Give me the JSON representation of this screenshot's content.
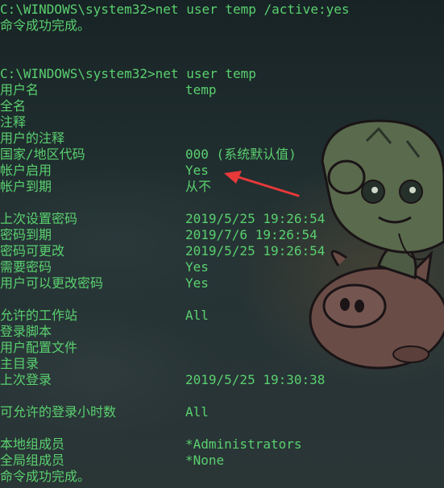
{
  "terminal": {
    "cmd1": "C:\\WINDOWS\\system32>net user temp /active:yes",
    "ok1": "命令成功完成。",
    "cmd2": "C:\\WINDOWS\\system32>net user temp",
    "fields": {
      "username": {
        "label": "用户名",
        "value": "temp"
      },
      "fullname": {
        "label": "全名",
        "value": ""
      },
      "comment": {
        "label": "注释",
        "value": ""
      },
      "user_comment": {
        "label": "用户的注释",
        "value": ""
      },
      "country_code": {
        "label": "国家/地区代码",
        "value": "000 (系统默认值)"
      },
      "account_active": {
        "label": "帐户启用",
        "value": "Yes"
      },
      "account_expires": {
        "label": "帐户到期",
        "value": "从不"
      },
      "pw_last_set": {
        "label": "上次设置密码",
        "value": "2019/5/25 19:26:54"
      },
      "pw_expires": {
        "label": "密码到期",
        "value": "2019/7/6 19:26:54"
      },
      "pw_changeable": {
        "label": "密码可更改",
        "value": "2019/5/25 19:26:54"
      },
      "pw_required": {
        "label": "需要密码",
        "value": "Yes"
      },
      "user_may_change": {
        "label": "用户可以更改密码",
        "value": "Yes"
      },
      "workstations": {
        "label": "允许的工作站",
        "value": "All"
      },
      "logon_script": {
        "label": "登录脚本",
        "value": ""
      },
      "profile": {
        "label": "用户配置文件",
        "value": ""
      },
      "home_dir": {
        "label": "主目录",
        "value": ""
      },
      "last_logon": {
        "label": "上次登录",
        "value": "2019/5/25 19:30:38"
      },
      "logon_hours": {
        "label": "可允许的登录小时数",
        "value": "All"
      },
      "local_groups": {
        "label": "本地组成员",
        "value": "*Administrators"
      },
      "global_groups": {
        "label": "全局组成员",
        "value": "*None"
      }
    },
    "ok2": "命令成功完成。"
  },
  "colors": {
    "text": "#5ad06f",
    "annotation_arrow": "#e8393a"
  }
}
